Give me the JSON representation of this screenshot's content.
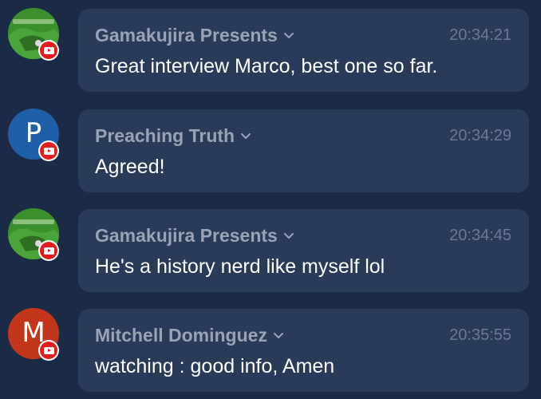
{
  "messages": [
    {
      "author": "Gamakujira Presents",
      "time": "20:34:21",
      "text": "Great interview Marco, best one so far.",
      "avatar": {
        "type": "image",
        "letter": "",
        "color": "#3a8f2e"
      },
      "platform_icon": "youtube-icon"
    },
    {
      "author": "Preaching Truth",
      "time": "20:34:29",
      "text": "Agreed!",
      "avatar": {
        "type": "letter",
        "letter": "P",
        "color": "#1f5fa8"
      },
      "platform_icon": "youtube-icon"
    },
    {
      "author": "Gamakujira Presents",
      "time": "20:34:45",
      "text": "He's a history nerd like myself lol",
      "avatar": {
        "type": "image",
        "letter": "",
        "color": "#3a8f2e"
      },
      "platform_icon": "youtube-icon"
    },
    {
      "author": "Mitchell Dominguez",
      "time": "20:35:55",
      "text": "watching : good info, Amen",
      "avatar": {
        "type": "letter",
        "letter": "M",
        "color": "#c2361b"
      },
      "platform_icon": "youtube-icon"
    }
  ],
  "colors": {
    "background": "#1b2a45",
    "bubble": "#2a3a59",
    "author": "#9aa3b5",
    "timestamp": "#6b7891",
    "message_text": "#ffffff",
    "youtube_red": "#e21d1d"
  }
}
